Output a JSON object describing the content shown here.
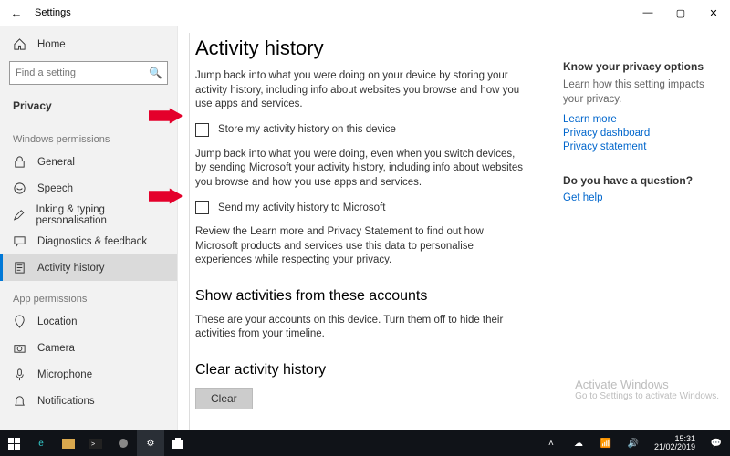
{
  "titlebar": {
    "title": "Settings"
  },
  "sidebar": {
    "home": "Home",
    "search_placeholder": "Find a setting",
    "section": "Privacy",
    "group_windows": "Windows permissions",
    "items_windows": [
      "General",
      "Speech",
      "Inking & typing personalisation",
      "Diagnostics & feedback",
      "Activity history"
    ],
    "group_app": "App permissions",
    "items_app": [
      "Location",
      "Camera",
      "Microphone",
      "Notifications"
    ]
  },
  "main": {
    "h1": "Activity history",
    "p1": "Jump back into what you were doing on your device by storing your activity history, including info about websites you browse and how you use apps and services.",
    "chk1": "Store my activity history on this device",
    "p2": "Jump back into what you were doing, even when you switch devices, by sending Microsoft your activity history, including info about websites you browse and how you use apps and services.",
    "chk2": "Send my activity history to Microsoft",
    "p3": "Review the Learn more and Privacy Statement to find out how Microsoft products and services use this data to personalise experiences while respecting your privacy.",
    "h2a": "Show activities from these accounts",
    "p4": "These are your accounts on this device. Turn them off to hide their activities from your timeline.",
    "h2b": "Clear activity history",
    "clear": "Clear"
  },
  "aside": {
    "h1": "Know your privacy options",
    "p1": "Learn how this setting impacts your privacy.",
    "links": [
      "Learn more",
      "Privacy dashboard",
      "Privacy statement"
    ],
    "qh": "Do you have a question?",
    "qlink": "Get help"
  },
  "watermark": {
    "l1": "Activate Windows",
    "l2": "Go to Settings to activate Windows."
  },
  "taskbar": {
    "time": "15:31",
    "date": "21/02/2019"
  }
}
